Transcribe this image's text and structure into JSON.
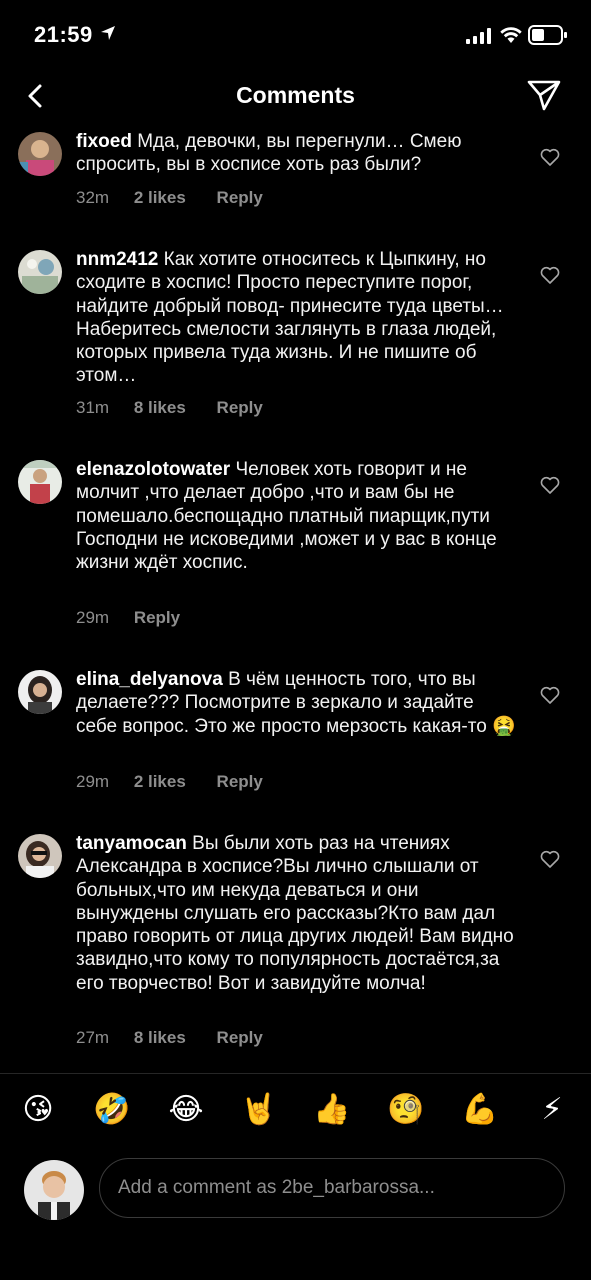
{
  "status_bar": {
    "time": "21:59"
  },
  "nav": {
    "title": "Comments"
  },
  "comments": [
    {
      "username": "fixoed",
      "text": "Мда, девочки, вы перегнули… Смею спросить, вы в хосписе хоть раз были?",
      "time": "32m",
      "likes": "2 likes",
      "reply": "Reply"
    },
    {
      "username": "nnm2412",
      "text": "Как хотите относитесь к Цыпкину, но сходите в хоспис! Просто переступите порог, найдите добрый повод- принесите туда цветы… Наберитесь смелости заглянуть в глаза людей, которых привела туда жизнь. И не пишите об этом…",
      "time": "31m",
      "likes": "8 likes",
      "reply": "Reply"
    },
    {
      "username": "elenazolotowater",
      "text": "Человек хоть говорит и не молчит ,что делает добро ,что и вам бы не помешало.беспощадно платный пиарщик,пути Господни не исковедими ,может и у вас в конце жизни ждёт хоспис.",
      "time": "29m",
      "likes": "",
      "reply": "Reply"
    },
    {
      "username": "elina_delyanova",
      "text": "В чём ценность того, что вы делаете??? Посмотрите в зеркало и задайте себе вопрос. Это же просто мерзость какая-то 🤮",
      "time": "29m",
      "likes": "2 likes",
      "reply": "Reply"
    },
    {
      "username": "tanyamocan",
      "text": "Вы были хоть раз на чтениях Александра в хосписе?Вы лично слышали от больных,что им некуда деваться и они вынуждены слушать его рассказы?Кто вам дал право говорить от лица других людей! Вам видно завидно,что кому то популярность достаётся,за его творчество! Вот и завидуйте молча!",
      "time": "27m",
      "likes": "8 likes",
      "reply": "Reply"
    }
  ],
  "emoji_bar": [
    "😘",
    "🤣",
    "😂",
    "🤘",
    "👍",
    "🧐",
    "💪",
    "⚡"
  ],
  "composer": {
    "placeholder": "Add a comment as 2be_barbarossa..."
  }
}
